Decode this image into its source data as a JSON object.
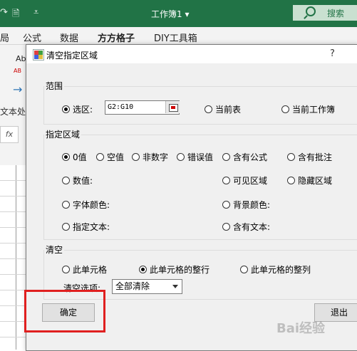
{
  "excel": {
    "title": "工作簿1",
    "title_suffix": "▾",
    "search_label": "搜索",
    "menu": [
      "公式",
      "数据",
      "方方格子",
      "DIY工具箱"
    ],
    "menu_partial": "局",
    "ribbon_ab": "Ab",
    "ribbon_ab2": "AB",
    "ribbon_text": "文本处",
    "fx": "fx"
  },
  "dialog": {
    "title": "清空指定区域",
    "help": "?",
    "range_group": {
      "title": "范围",
      "selection_label": "选区:",
      "selection_value": "G2:G10",
      "current_sheet": "当前表",
      "current_workbook": "当前工作簿"
    },
    "area_group": {
      "title": "指定区域",
      "options": {
        "zero": "0值",
        "empty": "空值",
        "non_number": "非数字",
        "error": "错误值",
        "formula": "含有公式",
        "comment": "含有批注",
        "number": "数值:",
        "visible": "可见区域",
        "hidden": "隐藏区域",
        "font_color": "字体颜色:",
        "bg_color": "背景颜色:",
        "text": "指定文本:",
        "contains_text": "含有文本:"
      }
    },
    "clear_group": {
      "title": "清空",
      "this_cell": "此单元格",
      "whole_row": "此单元格的整行",
      "whole_col": "此单元格的整列",
      "option_label": "清空选项:",
      "option_value": "全部清除"
    },
    "ok_label": "确定",
    "exit_label": "退出"
  },
  "watermark": "Bai经验"
}
